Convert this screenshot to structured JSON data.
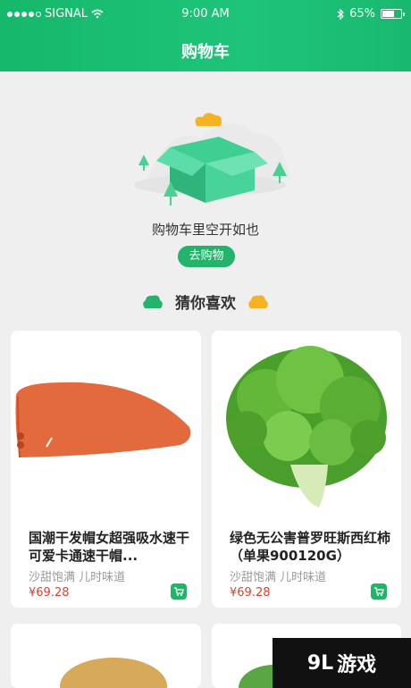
{
  "status_bar": {
    "carrier": "SIGNAL",
    "time": "9:00 AM",
    "battery": "65%",
    "battery_level": 0.65
  },
  "header": {
    "title": "购物车"
  },
  "empty_cart": {
    "message": "购物车里空开如也",
    "button_label": "去购物"
  },
  "recommend": {
    "title": "猜你喜欢"
  },
  "products": [
    {
      "name": "国潮干发帽女超强吸水速干可爱卡通速干帽...",
      "tags": "沙甜饱满 儿时味道",
      "price": "¥69.28",
      "icon": "hair-towel-cap-image"
    },
    {
      "name": "绿色无公害普罗旺斯西红柿（单果900120G）",
      "tags": "沙甜饱满 儿时味道",
      "price": "¥69.28",
      "icon": "lettuce-image"
    }
  ],
  "watermark": {
    "text": "游戏",
    "logo": "9L"
  },
  "colors": {
    "brand_green": "#1ec47a",
    "price_red": "#e0402a",
    "accent_orange": "#f5b321"
  }
}
